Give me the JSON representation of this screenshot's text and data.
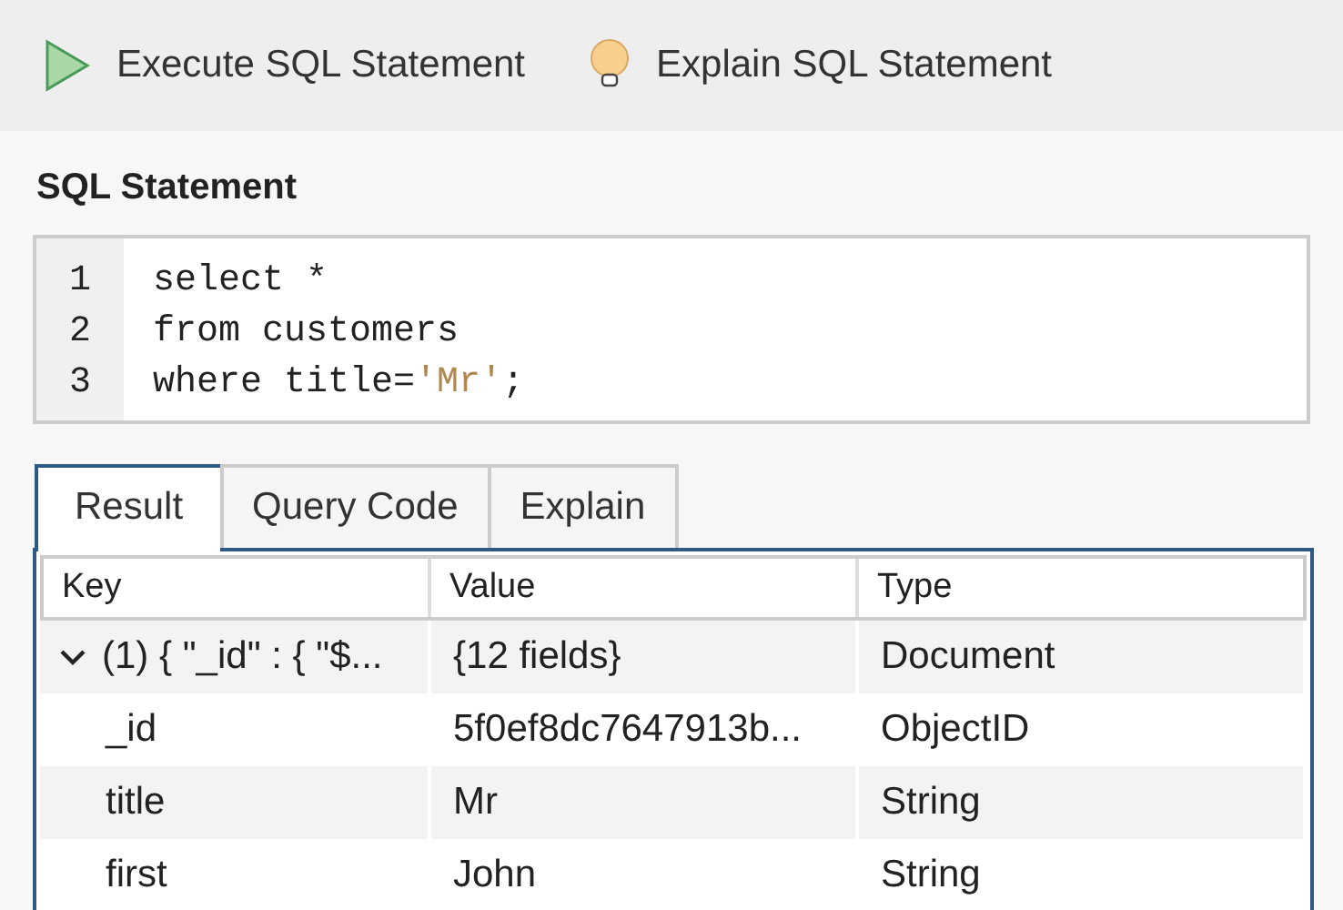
{
  "toolbar": {
    "buttons": [
      {
        "kind": "execute",
        "label": "Execute SQL Statement"
      },
      {
        "kind": "explain",
        "label": "Explain SQL Statement"
      }
    ]
  },
  "editor": {
    "title": "SQL Statement",
    "lines": [
      {
        "number": "1",
        "segments": [
          {
            "kind": "plain",
            "text": "select *"
          }
        ]
      },
      {
        "number": "2",
        "segments": [
          {
            "kind": "plain",
            "text": "from customers"
          }
        ]
      },
      {
        "number": "3",
        "segments": [
          {
            "kind": "plain",
            "text": "where title="
          },
          {
            "kind": "string",
            "text": "'Mr'"
          },
          {
            "kind": "plain",
            "text": ";"
          }
        ]
      }
    ]
  },
  "tabs": [
    {
      "label": "Result",
      "selected": true
    },
    {
      "label": "Query Code",
      "selected": false
    },
    {
      "label": "Explain",
      "selected": false
    }
  ],
  "table": {
    "columns": [
      "Key",
      "Value",
      "Type"
    ],
    "rows": [
      {
        "key": "(1) { \"_id\" : { \"$...",
        "value": "{12 fields}",
        "type": "Document",
        "expanded": true,
        "children": [
          {
            "key": "_id",
            "value": "5f0ef8dc7647913b...",
            "type": "ObjectID"
          },
          {
            "key": "title",
            "value": "Mr",
            "type": "String"
          },
          {
            "key": "first",
            "value": "John",
            "type": "String"
          }
        ]
      }
    ]
  }
}
